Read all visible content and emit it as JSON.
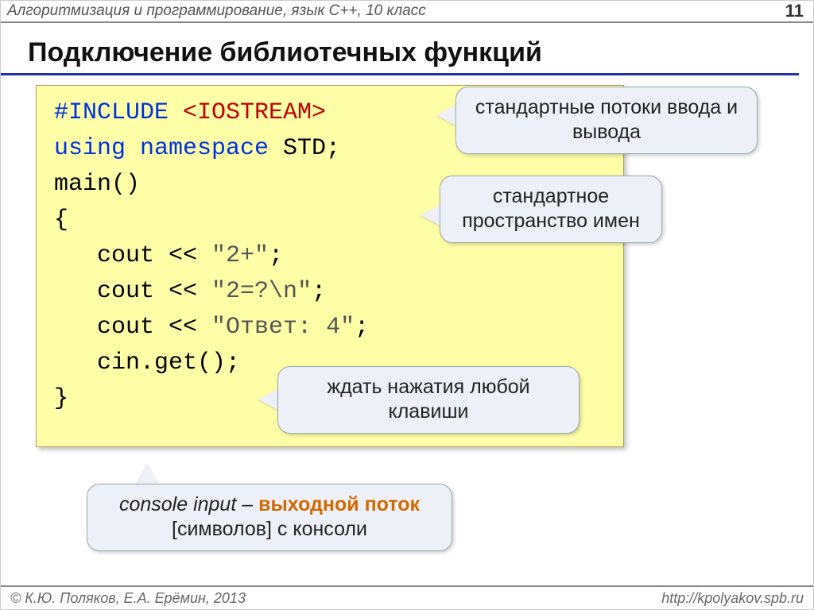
{
  "header": {
    "course": "Алгоритмизация и программирование, язык  C++, 10 класс",
    "page": "11"
  },
  "title": "Подключение библиотечных функций",
  "code": {
    "l1a": "#INCLUDE ",
    "l1b": "<IOSTREAM>",
    "l2a": "using namespace",
    "l2b": " STD;",
    "l3": "main()",
    "l4": "{",
    "l5a": "   cout << ",
    "l5b": "\"2+\"",
    "l5c": ";",
    "l6a": "   cout << ",
    "l6b": "\"2=?\\n\"",
    "l6c": ";",
    "l7a": "   cout << ",
    "l7b": "\"Ответ: 4\"",
    "l7c": ";",
    "l8": "   cin.get();",
    "l9": "}"
  },
  "callouts": {
    "c1": "стандартные потоки ввода и вывода",
    "c2": "стандартное пространство имен",
    "c3": "ждать нажатия любой клавиши",
    "c4_it": "console input",
    "c4_dash": " – ",
    "c4_bold": "выходной поток",
    "c4_rest": " [символов] с консоли"
  },
  "footer": {
    "left": "© К.Ю. Поляков, Е.А. Ерёмин, 2013",
    "right": "http://kpolyakov.spb.ru"
  }
}
